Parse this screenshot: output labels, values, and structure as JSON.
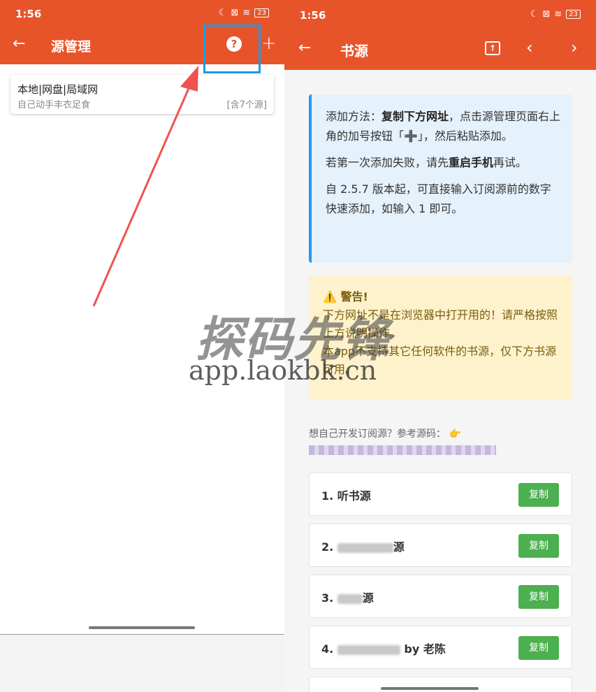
{
  "left": {
    "status": {
      "time": "1:56",
      "icons": [
        "moon-icon",
        "sim-x-icon",
        "wifi-icon"
      ],
      "battery": "23"
    },
    "appbar": {
      "back": "←",
      "title": "源管理",
      "help": "?",
      "add": "+"
    },
    "source": {
      "name": "本地|网盘|局域网",
      "subtitle": "自己动手丰衣足食",
      "count": "[含7个源]"
    }
  },
  "right": {
    "status": {
      "time": "1:56",
      "battery": "23"
    },
    "appbar": {
      "back": "←",
      "title": "书源",
      "prev": "‹",
      "next": "›"
    },
    "info": {
      "p1_a": "添加方法：",
      "p1_b": "复制下方网址",
      "p1_c": "，点击源管理页面右上角的加号按钮「➕」，然后粘贴添加。",
      "p2_a": "若第一次添加失败，请先",
      "p2_b": "重启手机",
      "p2_c": "再试。",
      "p3": "自 2.5.7 版本起，可直接输入订阅源前的数字快速添加，如输入 1 即可。"
    },
    "warning": {
      "title": "⚠️ 警告!",
      "p1": "下方网址不是在浏览器中打开用的！请严格按照上方说明操作。",
      "p2": "本app不支持其它任何软件的书源，仅下方书源可用。"
    },
    "dev_line": "想自己开发订阅源？参考源码： 👉",
    "items": [
      {
        "prefix": "1. 听书源",
        "suffix": "",
        "button": "复制"
      },
      {
        "prefix": "2.",
        "suffix": "源",
        "button": "复制"
      },
      {
        "prefix": "3.",
        "suffix": "源",
        "button": "复制"
      },
      {
        "prefix": "4.",
        "suffix": "by 老陈",
        "button": "复制"
      }
    ]
  },
  "watermark": {
    "title": "探码先锋",
    "url": "app.laokbk.cn"
  },
  "colors": {
    "brand": "#e8542a",
    "info_border": "#2196f3",
    "copy_button": "#4caf50",
    "highlight": "#1a9de8",
    "arrow": "#ef5350"
  }
}
